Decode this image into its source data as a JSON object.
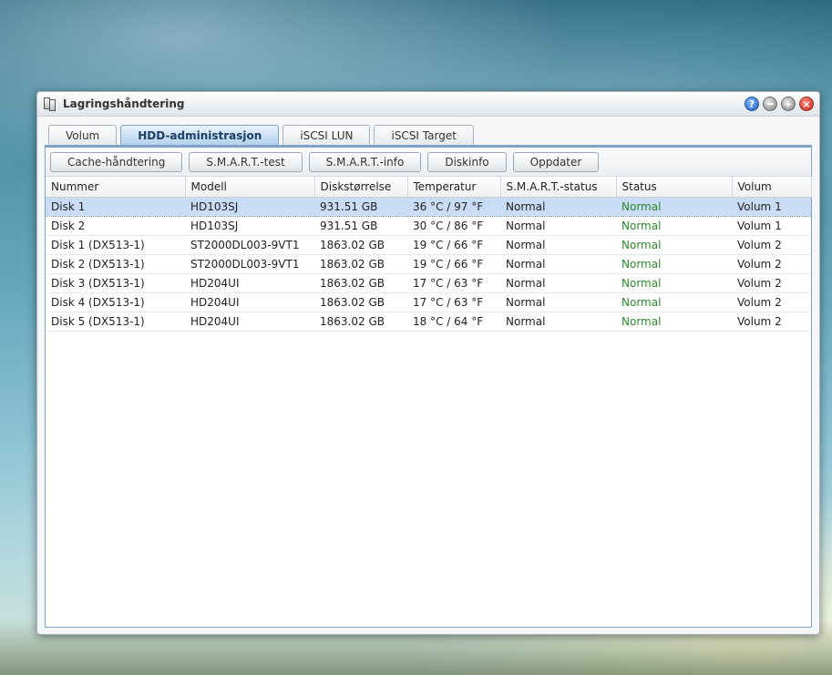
{
  "window": {
    "title": "Lagringshåndtering",
    "buttons": {
      "help": "?",
      "maximize": "+",
      "close": "×"
    }
  },
  "tabs": [
    {
      "label": "Volum",
      "active": false
    },
    {
      "label": "HDD-administrasjon",
      "active": true
    },
    {
      "label": "iSCSI LUN",
      "active": false
    },
    {
      "label": "iSCSI Target",
      "active": false
    }
  ],
  "toolbar": {
    "cache": "Cache-håndtering",
    "smart_test": "S.M.A.R.T.-test",
    "smart_info": "S.M.A.R.T.-info",
    "diskinfo": "Diskinfo",
    "refresh": "Oppdater"
  },
  "table": {
    "columns": [
      "Nummer",
      "Modell",
      "Diskstørrelse",
      "Temperatur",
      "S.M.A.R.T.-status",
      "Status",
      "Volum"
    ],
    "rows": [
      [
        "Disk 1",
        "HD103SJ",
        "931.51 GB",
        "36 °C / 97 °F",
        "Normal",
        "Normal",
        "Volum 1"
      ],
      [
        "Disk 2",
        "HD103SJ",
        "931.51 GB",
        "30 °C / 86 °F",
        "Normal",
        "Normal",
        "Volum 1"
      ],
      [
        "Disk 1 (DX513-1)",
        "ST2000DL003-9VT1",
        "1863.02 GB",
        "19 °C / 66 °F",
        "Normal",
        "Normal",
        "Volum 2"
      ],
      [
        "Disk 2 (DX513-1)",
        "ST2000DL003-9VT1",
        "1863.02 GB",
        "19 °C / 66 °F",
        "Normal",
        "Normal",
        "Volum 2"
      ],
      [
        "Disk 3 (DX513-1)",
        "HD204UI",
        "1863.02 GB",
        "17 °C / 63 °F",
        "Normal",
        "Normal",
        "Volum 2"
      ],
      [
        "Disk 4 (DX513-1)",
        "HD204UI",
        "1863.02 GB",
        "17 °C / 63 °F",
        "Normal",
        "Normal",
        "Volum 2"
      ],
      [
        "Disk 5 (DX513-1)",
        "HD204UI",
        "1863.02 GB",
        "18 °C / 64 °F",
        "Normal",
        "Normal",
        "Volum 2"
      ]
    ],
    "selected_row": 0
  },
  "colors": {
    "status_ok": "#2a8a2a",
    "selection": "#c8ddf5",
    "active_tab": "#b3d1ec"
  }
}
